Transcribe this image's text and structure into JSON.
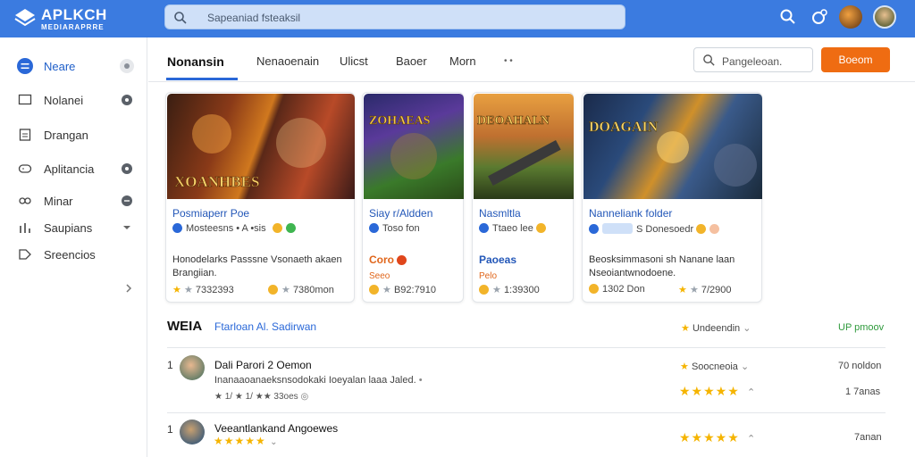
{
  "app": {
    "title": "APLKCH",
    "subtitle": "MEDIARAPRRE"
  },
  "search": {
    "placeholder": "Sapeaniad fsteaksil"
  },
  "sidebar": {
    "items": [
      {
        "label": "Neare",
        "icon": "menu-icon"
      },
      {
        "label": "Nolanei",
        "icon": "monitor-icon"
      },
      {
        "label": "Drangan",
        "icon": "document-icon"
      },
      {
        "label": "Aplitancia",
        "icon": "controller-icon"
      },
      {
        "label": "Minar",
        "icon": "gamepad-icon"
      },
      {
        "label": "Saupians",
        "icon": "chart-icon"
      },
      {
        "label": "Sreencios",
        "icon": "tag-icon"
      }
    ]
  },
  "tabs": [
    "Nonansin",
    "Nenaoenain",
    "Ulicst",
    "Baoer",
    "Morn"
  ],
  "tab_more": "• •",
  "toolbar": {
    "search_placeholder": "Pangeleoan.",
    "button_label": "Boeom"
  },
  "cards": [
    {
      "art_text": "XOANHBES",
      "title": "Posmiaperr Poe",
      "meta": "Mosteesns  •  A •sis",
      "desc": "Honodelarks Passsne Vsonaeth akaen Brangiian.",
      "foot_left": "7332393",
      "foot_right": "7380mon"
    },
    {
      "art_text": "ZOHAEAS",
      "title": "Siay r/Aldden",
      "meta": "Toso fon",
      "desc": "Coro",
      "desc2": "Seeo",
      "foot_left": "B92:7910"
    },
    {
      "art_text": "DEOAHALN",
      "title": "Nasmltla",
      "meta": "Ttaeo lee",
      "desc": "Paoeas",
      "desc2": "Pelo",
      "foot_left": "1:39300"
    },
    {
      "art_text": "DOAGAIN",
      "title": "Nanneliank folder",
      "meta": "S  Donesoedr",
      "desc": "Beosksimmasoni sh Nanane laan Nseoiantwnodoene.",
      "foot_left": "1302 Don",
      "foot_right": "7/2900"
    }
  ],
  "section": {
    "title": "WEIA",
    "subtitle": "Ftarloan Al. Sadirwan",
    "sort_label": "Undeendin",
    "right_label": "UP pmoov"
  },
  "rows": [
    {
      "rank": "1",
      "title": "Dali Parori 2 Oemon",
      "desc": "Inanaaoanaeksnsodokaki Ioeyalan laaa Jaled.",
      "meta": "★ 1/ ★ 1/ ★★ 33oes",
      "filter": "Soocneoia",
      "count": "70 noldon",
      "count2": "1 7anas"
    },
    {
      "rank": "1",
      "title": "Veeantlankand Angoewes",
      "count2": "7anan"
    }
  ]
}
